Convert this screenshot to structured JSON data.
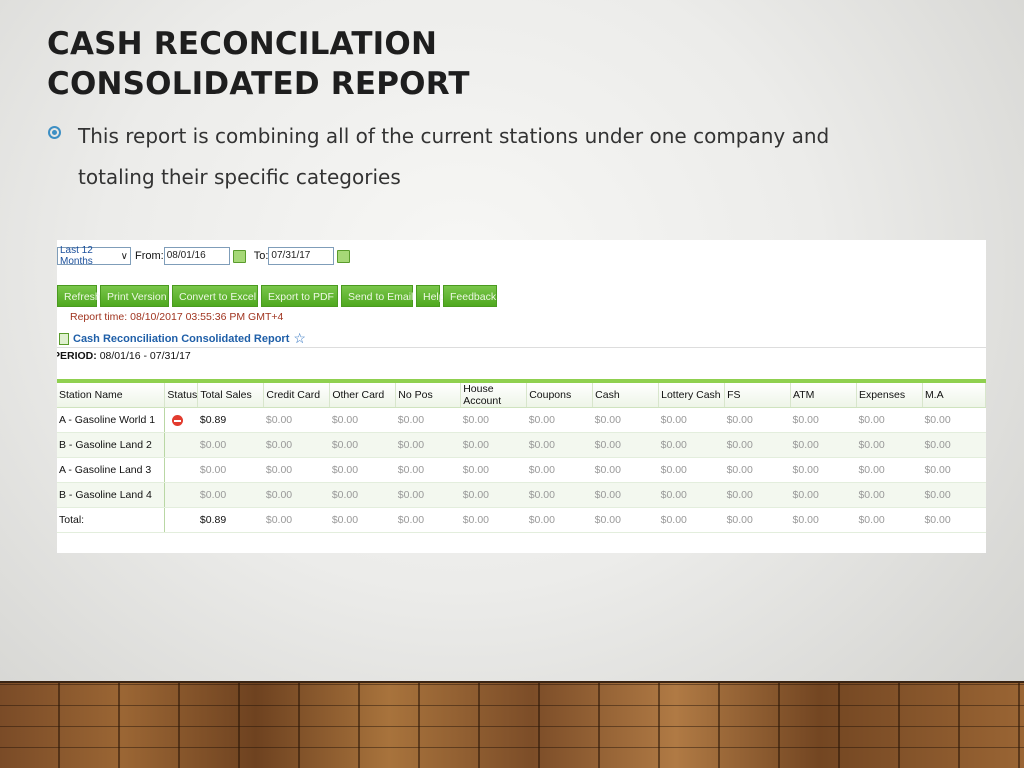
{
  "slide": {
    "title_line1": "CASH RECONCILATION",
    "title_line2": "CONSOLIDATED REPORT",
    "bullet_line1": "This report is combining all of the current stations under one company and",
    "bullet_line2": "totaling their specific categories"
  },
  "report": {
    "range_select": "Last 12 Months",
    "from_label": "From:",
    "from_value": "08/01/16",
    "to_label": "To:",
    "to_value": "07/31/17",
    "buttons": {
      "refresh": "Refresh",
      "print": "Print Version",
      "excel": "Convert to Excel",
      "pdf": "Export to PDF",
      "email": "Send to Email",
      "help": "Help",
      "feedback": "Feedback"
    },
    "report_time": "Report time: 08/10/2017 03:55:36 PM GMT+4",
    "title": "Cash Reconciliation Consolidated Report",
    "period_label": "PERIOD:",
    "period_value": "08/01/16 - 07/31/17",
    "columns": [
      "Station Name",
      "Status",
      "Total Sales",
      "Credit Card",
      "Other Card",
      "No Pos",
      "House Account",
      "Coupons",
      "Cash",
      "Lottery Cash",
      "FS",
      "ATM",
      "Expenses",
      "M.A"
    ],
    "rows": [
      {
        "name": "A - Gasoline World 1",
        "status": "error",
        "values": [
          "$0.89",
          "$0.00",
          "$0.00",
          "$0.00",
          "$0.00",
          "$0.00",
          "$0.00",
          "$0.00",
          "$0.00",
          "$0.00",
          "$0.00",
          "$0.00"
        ]
      },
      {
        "name": "B - Gasoline Land 2",
        "status": "",
        "values": [
          "$0.00",
          "$0.00",
          "$0.00",
          "$0.00",
          "$0.00",
          "$0.00",
          "$0.00",
          "$0.00",
          "$0.00",
          "$0.00",
          "$0.00",
          "$0.00"
        ]
      },
      {
        "name": "A - Gasoline Land 3",
        "status": "",
        "values": [
          "$0.00",
          "$0.00",
          "$0.00",
          "$0.00",
          "$0.00",
          "$0.00",
          "$0.00",
          "$0.00",
          "$0.00",
          "$0.00",
          "$0.00",
          "$0.00"
        ]
      },
      {
        "name": "B - Gasoline Land 4",
        "status": "",
        "values": [
          "$0.00",
          "$0.00",
          "$0.00",
          "$0.00",
          "$0.00",
          "$0.00",
          "$0.00",
          "$0.00",
          "$0.00",
          "$0.00",
          "$0.00",
          "$0.00"
        ]
      },
      {
        "name": "Total:",
        "status": "",
        "values": [
          "$0.89",
          "$0.00",
          "$0.00",
          "$0.00",
          "$0.00",
          "$0.00",
          "$0.00",
          "$0.00",
          "$0.00",
          "$0.00",
          "$0.00",
          "$0.00"
        ]
      }
    ]
  },
  "colors": {
    "accent_green": "#4fa81f",
    "bullet_blue": "#3d8fc4",
    "report_time_red": "#a0341f",
    "status_error_red": "#e23b2e"
  }
}
